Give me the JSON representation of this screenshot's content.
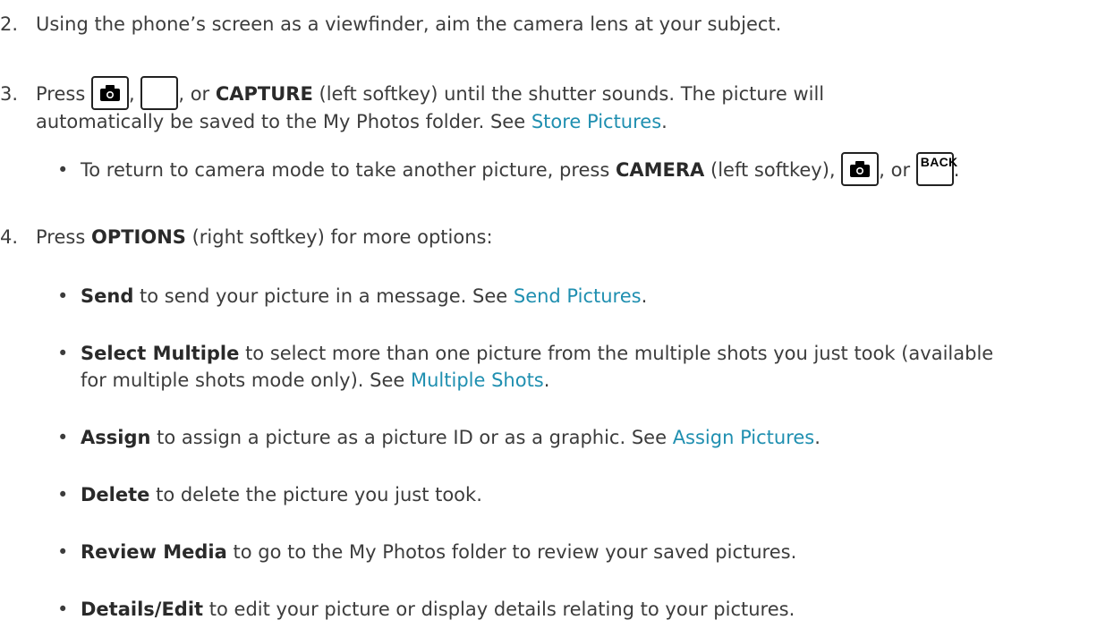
{
  "steps": {
    "s2": {
      "num": "2.",
      "text": "Using the phone’s screen as a viewfinder, aim the camera lens at your subject."
    },
    "s3": {
      "num": "3.",
      "press": "Press",
      "comma1": ",",
      "or_prefix": ", or",
      "capture": "CAPTURE",
      "rest_line1": "(left softkey) until the shutter sounds. The picture will",
      "rest_line2": "automatically be saved to the My Photos folder. See",
      "link": "Store Pictures",
      "period": "."
    },
    "s3_bullet": {
      "before": "To return to camera mode to take another picture, press",
      "camera": "CAMERA",
      "middle": "(left softkey),",
      "or": ", or",
      "back_key": "BACK",
      "period": "."
    },
    "s4": {
      "num": "4.",
      "press": "Press",
      "options": "OPTIONS",
      "rest": "(right softkey) for more options:"
    }
  },
  "options": [
    {
      "bold": "Send",
      "text": "to send your picture in a message. See",
      "link": "Send Pictures",
      "tail": "."
    },
    {
      "bold": "Select Multiple",
      "text": "to select more than one picture from the multiple shots you just took (available",
      "text2": "for multiple shots mode only). See",
      "link": "Multiple Shots",
      "tail": "."
    },
    {
      "bold": "Assign",
      "text": "to assign a picture as a picture ID or as a graphic. See",
      "link": "Assign Pictures",
      "tail": "."
    },
    {
      "bold": "Delete",
      "text": "to delete the picture you just took."
    },
    {
      "bold": "Review Media",
      "text": "to go to the My Photos folder to review your saved pictures."
    },
    {
      "bold": "Details/Edit",
      "text": "to edit your picture or display details relating to your pictures."
    }
  ]
}
